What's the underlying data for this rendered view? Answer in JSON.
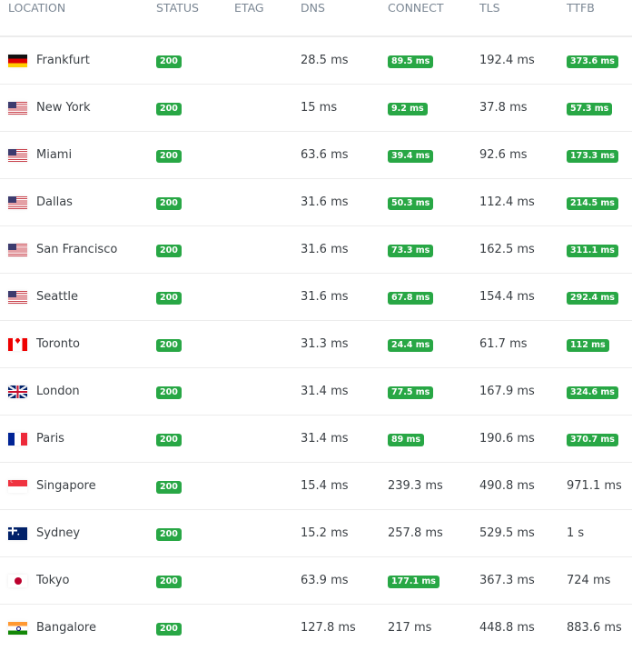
{
  "headers": {
    "location": "LOCATION",
    "status": "STATUS",
    "etag": "ETAG",
    "dns": "DNS",
    "connect": "CONNECT",
    "tls": "TLS",
    "ttfb": "TTFB"
  },
  "colors": {
    "badge_green": "#28a745",
    "header_text": "#7b8794",
    "row_divider": "#ececec"
  },
  "rows": [
    {
      "location": "Frankfurt",
      "flag": "germany-flag",
      "status": "200",
      "etag": "",
      "dns": "28.5 ms",
      "connect": "89.5 ms",
      "connect_badge": true,
      "tls": "192.4 ms",
      "ttfb": "373.6 ms",
      "ttfb_badge": true
    },
    {
      "location": "New York",
      "flag": "usa-flag",
      "status": "200",
      "etag": "",
      "dns": "15 ms",
      "connect": "9.2 ms",
      "connect_badge": true,
      "tls": "37.8 ms",
      "ttfb": "57.3 ms",
      "ttfb_badge": true
    },
    {
      "location": "Miami",
      "flag": "usa-flag",
      "status": "200",
      "etag": "",
      "dns": "63.6 ms",
      "connect": "39.4 ms",
      "connect_badge": true,
      "tls": "92.6 ms",
      "ttfb": "173.3 ms",
      "ttfb_badge": true
    },
    {
      "location": "Dallas",
      "flag": "usa-flag",
      "status": "200",
      "etag": "",
      "dns": "31.6 ms",
      "connect": "50.3 ms",
      "connect_badge": true,
      "tls": "112.4 ms",
      "ttfb": "214.5 ms",
      "ttfb_badge": true
    },
    {
      "location": "San Francisco",
      "flag": "usa-flag",
      "status": "200",
      "etag": "",
      "dns": "31.6 ms",
      "connect": "73.3 ms",
      "connect_badge": true,
      "tls": "162.5 ms",
      "ttfb": "311.1 ms",
      "ttfb_badge": true
    },
    {
      "location": "Seattle",
      "flag": "usa-flag",
      "status": "200",
      "etag": "",
      "dns": "31.6 ms",
      "connect": "67.8 ms",
      "connect_badge": true,
      "tls": "154.4 ms",
      "ttfb": "292.4 ms",
      "ttfb_badge": true
    },
    {
      "location": "Toronto",
      "flag": "canada-flag",
      "status": "200",
      "etag": "",
      "dns": "31.3 ms",
      "connect": "24.4 ms",
      "connect_badge": true,
      "tls": "61.7 ms",
      "ttfb": "112 ms",
      "ttfb_badge": true
    },
    {
      "location": "London",
      "flag": "uk-flag",
      "status": "200",
      "etag": "",
      "dns": "31.4 ms",
      "connect": "77.5 ms",
      "connect_badge": true,
      "tls": "167.9 ms",
      "ttfb": "324.6 ms",
      "ttfb_badge": true
    },
    {
      "location": "Paris",
      "flag": "france-flag",
      "status": "200",
      "etag": "",
      "dns": "31.4 ms",
      "connect": "89 ms",
      "connect_badge": true,
      "tls": "190.6 ms",
      "ttfb": "370.7 ms",
      "ttfb_badge": true
    },
    {
      "location": "Singapore",
      "flag": "singapore-flag",
      "status": "200",
      "etag": "",
      "dns": "15.4 ms",
      "connect": "239.3 ms",
      "connect_badge": false,
      "tls": "490.8 ms",
      "ttfb": "971.1 ms",
      "ttfb_badge": false
    },
    {
      "location": "Sydney",
      "flag": "australia-flag",
      "status": "200",
      "etag": "",
      "dns": "15.2 ms",
      "connect": "257.8 ms",
      "connect_badge": false,
      "tls": "529.5 ms",
      "ttfb": "1 s",
      "ttfb_badge": false
    },
    {
      "location": "Tokyo",
      "flag": "japan-flag",
      "status": "200",
      "etag": "",
      "dns": "63.9 ms",
      "connect": "177.1 ms",
      "connect_badge": true,
      "tls": "367.3 ms",
      "ttfb": "724 ms",
      "ttfb_badge": false
    },
    {
      "location": "Bangalore",
      "flag": "india-flag",
      "status": "200",
      "etag": "",
      "dns": "127.8 ms",
      "connect": "217 ms",
      "connect_badge": false,
      "tls": "448.8 ms",
      "ttfb": "883.6 ms",
      "ttfb_badge": false
    }
  ]
}
